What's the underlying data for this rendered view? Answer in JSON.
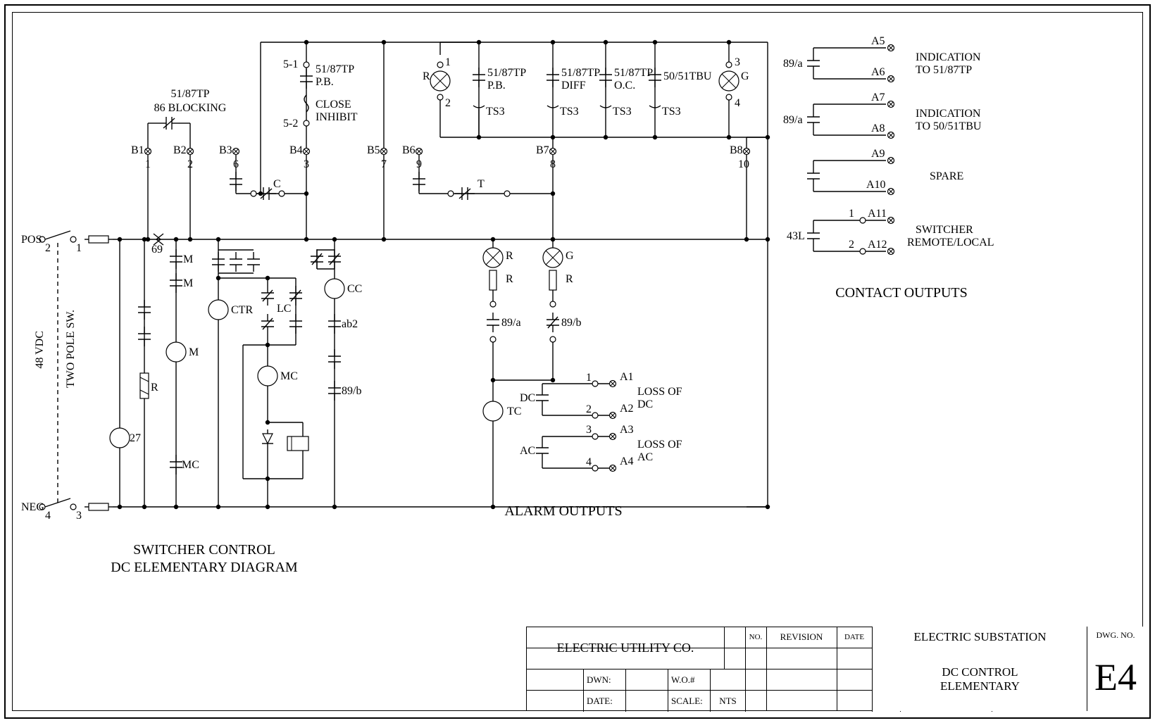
{
  "titles": {
    "diagram_line1": "SWITCHER CONTROL",
    "diagram_line2": "DC ELEMENTARY DIAGRAM",
    "contact_outputs": "CONTACT OUTPUTS",
    "alarm_outputs": "ALARM OUTPUTS"
  },
  "rail": {
    "voltage": "48 VDC",
    "pos": "POS",
    "neg": "NEG",
    "switch": "TWO POLE SW.",
    "pos_term": "2",
    "pos_fuse": "1",
    "neg_term": "4",
    "neg_fuse": "3"
  },
  "blocking": {
    "line1": "51/87TP",
    "line2": "86 BLOCKING"
  },
  "close_inhibit": {
    "t1": "5-1",
    "t2": "5-2",
    "label": "51/87TP",
    "pb": "P.B.",
    "ci1": "CLOSE",
    "ci2": "INHIBIT"
  },
  "center_col": {
    "ctr": "CTR",
    "m": "M",
    "mc_top": "MC",
    "mc_bot": "MC",
    "lc": "LC",
    "cc": "CC",
    "ab2": "ab2",
    "c89b": "89/b",
    "r": "R",
    "dev27": "27",
    "dev69": "69",
    "c_label": "C",
    "t_label": "T",
    "tc": "TC"
  },
  "lamps": {
    "r": "R",
    "g": "G",
    "c89a": "89/a",
    "c89b": "89/b"
  },
  "top_group": {
    "pb_label": "51/87TP",
    "pb_sub": "P.B.",
    "diff_label": "51/87TP",
    "diff_sub": "DIFF",
    "oc_label": "51/87TP",
    "oc_sub": "O.C.",
    "tbu_label": "50/51TBU",
    "ts3": "TS3",
    "r_top": "R",
    "g_top": "G",
    "t1": "1",
    "t2": "2",
    "t3": "3",
    "t4": "4"
  },
  "B": {
    "B1": "B1",
    "n1": "1",
    "B2": "B2",
    "n2": "2",
    "B3": "B3",
    "n3": "6",
    "B4": "B4",
    "n4": "3",
    "B5": "B5",
    "n5": "7",
    "B6": "B6",
    "n6": "9",
    "B7": "B7",
    "n7": "8",
    "B8": "B8",
    "n8": "10"
  },
  "alarm": {
    "dc": "DC",
    "ac": "AC",
    "a1": "A1",
    "a2": "A2",
    "a3": "A3",
    "a4": "A4",
    "loss_dc1": "LOSS OF",
    "loss_dc2": "DC",
    "loss_ac1": "LOSS OF",
    "loss_ac2": "AC",
    "n1": "1",
    "n2": "2",
    "n3": "3",
    "n4": "4"
  },
  "contact": {
    "c89a": "89/a",
    "c43l": "43L",
    "a5": "A5",
    "a6": "A6",
    "a7": "A7",
    "a8": "A8",
    "a9": "A9",
    "a10": "A10",
    "a11": "A11",
    "a12": "A12",
    "ind1a": "INDICATION",
    "ind1b": "TO 51/87TP",
    "ind2a": "INDICATION",
    "ind2b": "TO 50/51TBU",
    "spare": "SPARE",
    "remote1": "SWITCHER",
    "remote2": "REMOTE/LOCAL",
    "n1": "1",
    "n2": "2"
  },
  "titleblock": {
    "company": "ELECTRIC UTILITY CO.",
    "dwn": "DWN:",
    "date": "DATE:",
    "wo": "W.O.#",
    "scale": "SCALE:",
    "nts": "NTS",
    "no": "NO.",
    "rev": "REVISION",
    "date2": "DATE",
    "proj": "ELECTRIC SUBSTATION",
    "title1": "DC CONTROL",
    "title2": "ELEMENTARY",
    "dwgno": "DWG. NO.",
    "sheet": "E4"
  }
}
